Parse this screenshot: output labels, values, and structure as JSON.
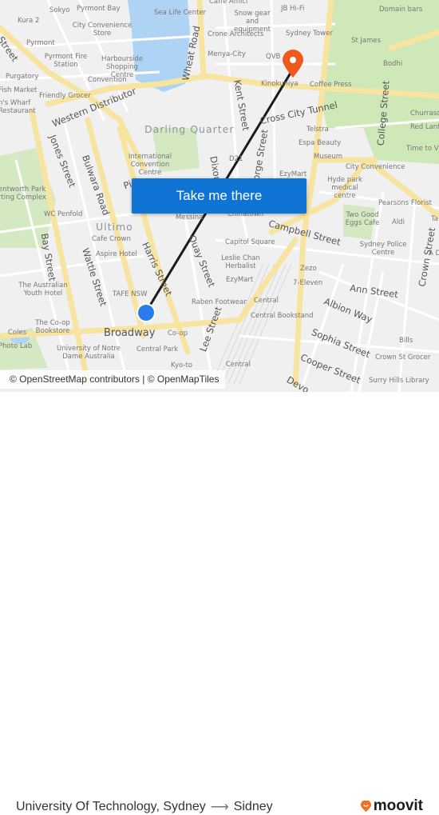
{
  "map": {
    "destination_pin_color": "#ee5a1e",
    "origin_dot_color": "#2b7bec",
    "route_line_color": "#1b1b1b",
    "labels": {
      "sokyo": "Sokyo",
      "pyrmont_bay": "Pyrmont Bay",
      "sea_life": "Sea Life Center",
      "caffe_amici": "Caffe Amici",
      "snow_gear": "Snow gear and equipment",
      "jb_hifi": "JB Hi-Fi",
      "domain_bars": "Domain bars",
      "kura2": "Kura 2",
      "city_conv_store": "City Convenience Store",
      "crone": "Crone Architects",
      "sydney_tower": "Sydney Tower",
      "pyrmont": "Pyrmont",
      "menya": "Menya-City",
      "qvb": "QVB",
      "st_james": "St James",
      "pyrmont_fire": "Pyrmont Fire Station",
      "harbourside": "Harbourside Shopping Centre",
      "bodhi": "Bodhi",
      "purgatory": "Purgatory",
      "convention": "Convention",
      "kinokuniya": "Kinokuniya",
      "coffee_press": "Coffee Press",
      "fish_market": "Fish Market",
      "friendly_grocer": "Friendly Grocer",
      "wharf": "n's Wharf Restaurant",
      "churrasco": "Churrasc",
      "red_lantern": "Red Lante",
      "telstra": "Telstra",
      "darling_quarter": "Darling Quarter",
      "espa": "Espa Beauty",
      "time_to": "Time to Vi",
      "icc": "International Convention Centre",
      "museum": "Museum",
      "d21": "D21",
      "ezymart1": "EzyMart",
      "city_convenience": "City Convenience",
      "hyde_park": "Hyde park medical centre",
      "wentworth": "entworth Park rting Complex",
      "pearsons": "Pearsons Florist",
      "wc_penfold": "WC Penfold",
      "messina": "Messina",
      "chinatown": "Chinatown",
      "two_good": "Two Good Eggs Cafe",
      "aldi": "Aldi",
      "ta": "Ta",
      "ultimo": "Ultimo",
      "cafe_crown": "Cafe Crown",
      "capitol_square": "Capitol Square",
      "sydney_police": "Sydney Police Centre",
      "a_d": "A D",
      "aspire": "Aspire Hotel",
      "leslie_chan": "Leslie Chan Herbalist",
      "zezo": "Zezo",
      "ezymart2": "EzyMart",
      "seven_eleven": "7-Eleven",
      "aus_youth": "The Australian Youth Hotel",
      "tafe": "TAFE NSW",
      "raben": "Raben Footwear",
      "central1": "Central",
      "central_bookstand": "Central Bookstand",
      "coop_bookstore": "The Co-op Bookstore",
      "coles": "Coles",
      "coop": "Co-op",
      "bills": "Bills",
      "photo_lab": "Photo Lab",
      "notre_dame": "University of Notre Dame Australia",
      "central_park": "Central Park",
      "crown_grocer": "Crown St Grocer",
      "kyoto": "Kyo-to",
      "central2": "Central",
      "surry_hills_lib": "Surry Hills Library"
    },
    "roads": {
      "western_distributor": "Western Distributor",
      "wheat_road": "Wheat Road",
      "kent_street": "Kent Street",
      "cross_city_tunnel": "Cross City Tunnel",
      "college_street": "College Street",
      "street_nw": "Street",
      "jones_street": "Jones Street",
      "bulwara_road": "Bulwara Road",
      "george_street": "George Street",
      "dixon": "Dixon",
      "pier": "Pi",
      "campbell_street": "Campbell Street",
      "bay_street": "Bay Street",
      "wattle_street": "Wattle Street",
      "harris_street": "Harris Street",
      "quay_street": "Quay Street",
      "crown_street": "Crown Street",
      "ann_street": "Ann Street",
      "albion_way": "Albion Way",
      "broadway": "Broadway",
      "lee_street": "Lee Street",
      "sophia_street": "Sophia Street",
      "cooper_street": "Cooper Street",
      "devonshire": "Devo"
    }
  },
  "cta": {
    "label": "Take me there"
  },
  "attribution": "© OpenStreetMap contributors | © OpenMapTiles",
  "footer": {
    "origin": "University Of Technology, Sydney",
    "arrow": "⟶",
    "destination": "Sidney",
    "brand": "moovit",
    "brand_color": "#f26f22"
  }
}
